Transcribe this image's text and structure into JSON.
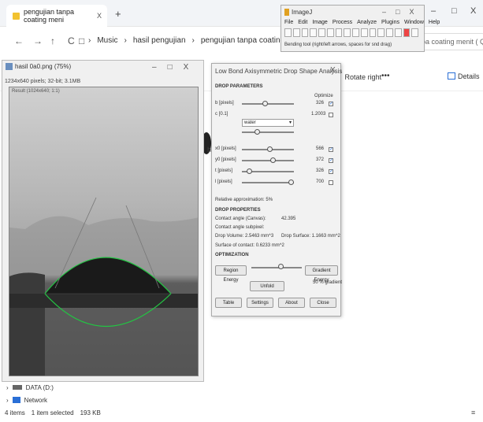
{
  "explorer": {
    "tab_title": "pengujian tanpa coating meni",
    "tab_close": "X",
    "new_tab": "+",
    "window_controls": {
      "minimize": "–",
      "maximize": "□",
      "close": "X"
    },
    "nav": {
      "back": "←",
      "forward": "→",
      "up": "↑",
      "refresh": "C",
      "view": "□"
    },
    "breadcrumb": [
      "›",
      "Music",
      "›",
      "hasil pengujian",
      "›",
      "pengujian tanpa coating menit 0"
    ],
    "search_text": "pa coating menit ( Q",
    "command_bar": {
      "rotate_right": "Rotate right",
      "more": "•••",
      "details": "Details"
    },
    "truncated_label": "ha",
    "tree": [
      {
        "expander": "›",
        "label": "DATA (D:)"
      },
      {
        "expander": "›",
        "label": "Network"
      }
    ],
    "status": {
      "items": "4 items",
      "selected": "1 item selected",
      "size": "193 KB"
    },
    "view_icon": "≡"
  },
  "image_window": {
    "title": "hasil 0a0.png (75%)",
    "controls": {
      "minimize": "–",
      "maximize": "□",
      "close": "X"
    },
    "info_text": "1234x640 pixels; 32-bit; 3.1MB",
    "canvas_label": "Result (1024x640; 1:1)"
  },
  "imagej": {
    "title": "ImageJ",
    "controls": {
      "minimize": "–",
      "maximize": "□",
      "close": "X"
    },
    "menu": [
      "File",
      "Edit",
      "Image",
      "Process",
      "Analyze",
      "Plugins",
      "Window",
      "Help"
    ],
    "tools_count": 16,
    "status": "Bending tool (right/left arrows, spaces for snd drag)"
  },
  "lbadsa": {
    "title": "Low Bond Axisymmetric Drop Shape Analysis",
    "close": "X",
    "section_drop_params": "DROP PARAMETERS",
    "optimize_label": "Optimize",
    "params": [
      {
        "label": "b [pixels]",
        "value": "326",
        "checked": true,
        "knob": 0.45
      },
      {
        "label": "c [0.1]",
        "value": "1.2003",
        "checked": false,
        "knob": 0.3
      },
      {
        "label": "x0 [pixels]",
        "value": "566",
        "checked": true,
        "knob": 0.55
      },
      {
        "label": "y0 [pixels]",
        "value": "372",
        "checked": true,
        "knob": 0.6
      },
      {
        "label": "t [pixels]",
        "value": "326",
        "checked": true,
        "knob": 0.15
      },
      {
        "label": "l [pixels]",
        "value": "700",
        "checked": false,
        "knob": 0.95
      }
    ],
    "select_value": "water",
    "relative_approx": "Relative approximation: 5%",
    "section_drop_props": "DROP PROPERTIES",
    "contact_angle_label": "Contact angle (Canvas):",
    "contact_angle_value": "42.395",
    "contact_angle_subpixel": "Contact angle subpixel:",
    "drop_volume": "Drop Volume: 2.5463 mm^3",
    "drop_surface": "Drop Surface: 1.1663 mm^2",
    "surface_contact": "Surface of contact: 0.6233 mm^2",
    "section_optimization": "OPTIMIZATION",
    "region_energy": "Region Energy",
    "gradient_energy": "Gradient Energy",
    "unfold": "Unfold",
    "gradient_pct": "50 % gradient",
    "optimization_knob": 0.6,
    "buttons": [
      "Table",
      "Settings",
      "About",
      "Close"
    ]
  },
  "colors": {
    "fit_curve": "#23c443",
    "folder": "#f2c230",
    "accent": "#2a6fd6"
  }
}
